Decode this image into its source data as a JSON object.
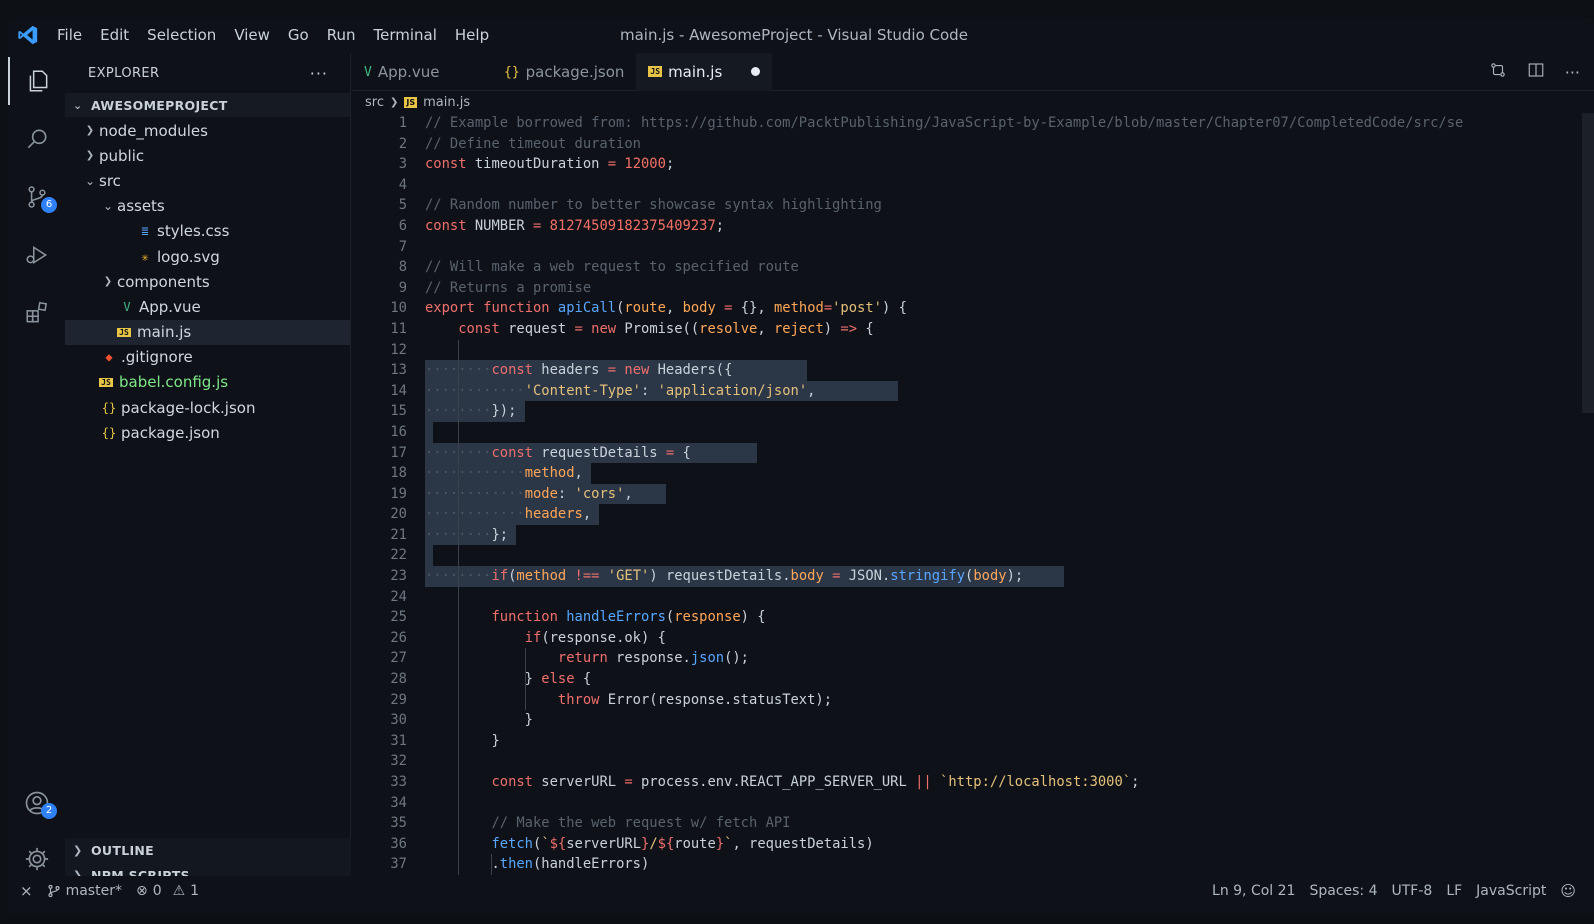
{
  "menu": [
    "File",
    "Edit",
    "Selection",
    "View",
    "Go",
    "Run",
    "Terminal",
    "Help"
  ],
  "window_title": "main.js - AwesomeProject - Visual Studio Code",
  "activity": {
    "source_control_badge": "6",
    "accounts_badge": "2"
  },
  "explorer": {
    "header": "EXPLORER",
    "project": "AWESOMEPROJECT",
    "tree": [
      {
        "label": "node_modules",
        "depth": 0,
        "twisty": ">",
        "icon": "",
        "color": "#d0d7de"
      },
      {
        "label": "public",
        "depth": 0,
        "twisty": ">",
        "icon": "",
        "color": "#d0d7de"
      },
      {
        "label": "src",
        "depth": 0,
        "twisty": "v",
        "icon": "",
        "color": "#d0d7de"
      },
      {
        "label": "assets",
        "depth": 1,
        "twisty": "v",
        "icon": "",
        "color": "#d0d7de"
      },
      {
        "label": "styles.css",
        "depth": 2,
        "twisty": "",
        "icon": "css",
        "color": "#d0d7de"
      },
      {
        "label": "logo.svg",
        "depth": 2,
        "twisty": "",
        "icon": "svg",
        "color": "#d0d7de"
      },
      {
        "label": "components",
        "depth": 1,
        "twisty": ">",
        "icon": "",
        "color": "#d0d7de"
      },
      {
        "label": "App.vue",
        "depth": 1,
        "twisty": "",
        "icon": "vue",
        "color": "#d0d7de"
      },
      {
        "label": "main.js",
        "depth": 1,
        "twisty": "",
        "icon": "js",
        "color": "#d0d7de",
        "selected": true
      },
      {
        "label": ".gitignore",
        "depth": 0,
        "twisty": "",
        "icon": "git",
        "color": "#d0d7de"
      },
      {
        "label": "babel.config.js",
        "depth": 0,
        "twisty": "",
        "icon": "js",
        "color": "#7ee787"
      },
      {
        "label": "package-lock.json",
        "depth": 0,
        "twisty": "",
        "icon": "json",
        "color": "#d0d7de"
      },
      {
        "label": "package.json",
        "depth": 0,
        "twisty": "",
        "icon": "json",
        "color": "#d0d7de"
      }
    ],
    "outline": "OUTLINE",
    "npm_scripts": "NPM SCRIPTS"
  },
  "tabs": [
    {
      "label": "App.vue",
      "icon": "vue",
      "active": false
    },
    {
      "label": "package.json",
      "icon": "json",
      "active": false
    },
    {
      "label": "main.js",
      "icon": "js",
      "active": true,
      "dirty": true
    }
  ],
  "breadcrumb": {
    "folder": "src",
    "file": "main.js"
  },
  "code_lines": [
    {
      "n": "1",
      "t": [
        [
          "c",
          "// Example borrowed from: https://github.com/PacktPublishing/JavaScript-by-Example/blob/master/Chapter07/CompletedCode/src/se"
        ]
      ]
    },
    {
      "n": "2",
      "t": [
        [
          "c",
          "// Define timeout duration"
        ]
      ]
    },
    {
      "n": "3",
      "t": [
        [
          "k",
          "const"
        ],
        [
          "w",
          " timeoutDuration "
        ],
        [
          "k",
          "="
        ],
        [
          "w",
          " "
        ],
        [
          "n",
          "12000"
        ],
        [
          "w",
          ";"
        ]
      ]
    },
    {
      "n": "4",
      "t": []
    },
    {
      "n": "5",
      "t": [
        [
          "c",
          "// Random number to better showcase syntax highlighting"
        ]
      ]
    },
    {
      "n": "6",
      "t": [
        [
          "k",
          "const"
        ],
        [
          "w",
          " NUMBER "
        ],
        [
          "k",
          "="
        ],
        [
          "w",
          " "
        ],
        [
          "n",
          "81274509182375409237"
        ],
        [
          "w",
          ";"
        ]
      ]
    },
    {
      "n": "7",
      "t": []
    },
    {
      "n": "8",
      "t": [
        [
          "c",
          "// Will make a web request to specified route"
        ]
      ]
    },
    {
      "n": "9",
      "t": [
        [
          "c",
          "// Returns a promise"
        ]
      ]
    },
    {
      "n": "10",
      "t": [
        [
          "k",
          "export"
        ],
        [
          "w",
          " "
        ],
        [
          "k",
          "function"
        ],
        [
          "w",
          " "
        ],
        [
          "f",
          "apiCall"
        ],
        [
          "w",
          "("
        ],
        [
          "p",
          "route"
        ],
        [
          "w",
          ", "
        ],
        [
          "p",
          "body"
        ],
        [
          "w",
          " "
        ],
        [
          "k",
          "="
        ],
        [
          "w",
          " {}, "
        ],
        [
          "p",
          "method"
        ],
        [
          "k",
          "="
        ],
        [
          "s",
          "'post'"
        ],
        [
          "w",
          ") {"
        ]
      ]
    },
    {
      "n": "11",
      "t": [
        [
          "w",
          "    "
        ],
        [
          "k",
          "const"
        ],
        [
          "w",
          " request "
        ],
        [
          "k",
          "="
        ],
        [
          "w",
          " "
        ],
        [
          "k",
          "new"
        ],
        [
          "w",
          " Promise(("
        ],
        [
          "p",
          "resolve"
        ],
        [
          "w",
          ", "
        ],
        [
          "p",
          "reject"
        ],
        [
          "w",
          ") "
        ],
        [
          "k",
          "=>"
        ],
        [
          "w",
          " {"
        ]
      ]
    },
    {
      "n": "12",
      "t": []
    },
    {
      "n": "13",
      "t": [
        [
          "d",
          "········"
        ],
        [
          "k",
          "const"
        ],
        [
          "w",
          " headers "
        ],
        [
          "k",
          "="
        ],
        [
          "w",
          " "
        ],
        [
          "k",
          "new"
        ],
        [
          "w",
          " Headers({"
        ]
      ],
      "sel": 46
    },
    {
      "n": "14",
      "t": [
        [
          "d",
          "············"
        ],
        [
          "s",
          "'Content-Type'"
        ],
        [
          "w",
          ": "
        ],
        [
          "s",
          "'application/json'"
        ],
        [
          "w",
          ","
        ]
      ],
      "sel": 57
    },
    {
      "n": "15",
      "t": [
        [
          "d",
          "········"
        ],
        [
          "w",
          "});"
        ]
      ],
      "sel": 12
    },
    {
      "n": "16",
      "t": [],
      "sel": 1
    },
    {
      "n": "17",
      "t": [
        [
          "d",
          "········"
        ],
        [
          "k",
          "const"
        ],
        [
          "w",
          " requestDetails "
        ],
        [
          "k",
          "="
        ],
        [
          "w",
          " {"
        ]
      ],
      "sel": 40
    },
    {
      "n": "18",
      "t": [
        [
          "d",
          "············"
        ],
        [
          "p",
          "method"
        ],
        [
          "w",
          ","
        ]
      ],
      "sel": 20
    },
    {
      "n": "19",
      "t": [
        [
          "d",
          "············"
        ],
        [
          "p",
          "mode"
        ],
        [
          "w",
          ": "
        ],
        [
          "s",
          "'cors'"
        ],
        [
          "w",
          ","
        ]
      ],
      "sel": 29
    },
    {
      "n": "20",
      "t": [
        [
          "d",
          "············"
        ],
        [
          "p",
          "headers"
        ],
        [
          "w",
          ","
        ]
      ],
      "sel": 21
    },
    {
      "n": "21",
      "t": [
        [
          "d",
          "········"
        ],
        [
          "w",
          "};"
        ]
      ],
      "sel": 11
    },
    {
      "n": "22",
      "t": [],
      "sel": 1
    },
    {
      "n": "23",
      "t": [
        [
          "d",
          "········"
        ],
        [
          "k",
          "if"
        ],
        [
          "w",
          "("
        ],
        [
          "p",
          "method"
        ],
        [
          "w",
          " "
        ],
        [
          "k",
          "!=="
        ],
        [
          "w",
          " "
        ],
        [
          "s",
          "'GET'"
        ],
        [
          "w",
          ") requestDetails."
        ],
        [
          "p",
          "body"
        ],
        [
          "w",
          " "
        ],
        [
          "k",
          "="
        ],
        [
          "w",
          " JSON."
        ],
        [
          "f",
          "stringify"
        ],
        [
          "w",
          "("
        ],
        [
          "p",
          "body"
        ],
        [
          "w",
          ");"
        ]
      ],
      "sel": 77
    },
    {
      "n": "24",
      "t": []
    },
    {
      "n": "25",
      "t": [
        [
          "w",
          "        "
        ],
        [
          "k",
          "function"
        ],
        [
          "w",
          " "
        ],
        [
          "f",
          "handleErrors"
        ],
        [
          "w",
          "("
        ],
        [
          "p",
          "response"
        ],
        [
          "w",
          ") {"
        ]
      ]
    },
    {
      "n": "26",
      "t": [
        [
          "w",
          "            "
        ],
        [
          "k",
          "if"
        ],
        [
          "w",
          "(response.ok) {"
        ]
      ]
    },
    {
      "n": "27",
      "t": [
        [
          "w",
          "                "
        ],
        [
          "k",
          "return"
        ],
        [
          "w",
          " response."
        ],
        [
          "f",
          "json"
        ],
        [
          "w",
          "();"
        ]
      ]
    },
    {
      "n": "28",
      "t": [
        [
          "w",
          "            } "
        ],
        [
          "k",
          "else"
        ],
        [
          "w",
          " {"
        ]
      ]
    },
    {
      "n": "29",
      "t": [
        [
          "w",
          "                "
        ],
        [
          "k",
          "throw"
        ],
        [
          "w",
          " Error(response.statusText);"
        ]
      ]
    },
    {
      "n": "30",
      "t": [
        [
          "w",
          "            }"
        ]
      ]
    },
    {
      "n": "31",
      "t": [
        [
          "w",
          "        }"
        ]
      ]
    },
    {
      "n": "32",
      "t": []
    },
    {
      "n": "33",
      "t": [
        [
          "w",
          "        "
        ],
        [
          "k",
          "const"
        ],
        [
          "w",
          " serverURL "
        ],
        [
          "k",
          "="
        ],
        [
          "w",
          " process.env.REACT_APP_SERVER_URL "
        ],
        [
          "k",
          "||"
        ],
        [
          "w",
          " "
        ],
        [
          "s",
          "`http://localhost:3000`"
        ],
        [
          "w",
          ";"
        ]
      ]
    },
    {
      "n": "34",
      "t": []
    },
    {
      "n": "35",
      "t": [
        [
          "w",
          "        "
        ],
        [
          "c",
          "// Make the web request w/ fetch API"
        ]
      ]
    },
    {
      "n": "36",
      "t": [
        [
          "w",
          "        "
        ],
        [
          "f",
          "fetch"
        ],
        [
          "w",
          "("
        ],
        [
          "s",
          "`"
        ],
        [
          "k",
          "${"
        ],
        [
          "w",
          "serverURL"
        ],
        [
          "k",
          "}"
        ],
        [
          "s",
          "/"
        ],
        [
          "k",
          "${"
        ],
        [
          "w",
          "route"
        ],
        [
          "k",
          "}"
        ],
        [
          "s",
          "`"
        ],
        [
          "w",
          ", requestDetails)"
        ]
      ]
    },
    {
      "n": "37",
      "t": [
        [
          "w",
          "        ."
        ],
        [
          "f",
          "then"
        ],
        [
          "w",
          "(handleErrors)"
        ]
      ]
    }
  ],
  "status": {
    "branch": "master*",
    "errors": "0",
    "warnings": "1",
    "position": "Ln 9, Col 21",
    "spaces": "Spaces: 4",
    "encoding": "UTF-8",
    "eol": "LF",
    "language": "JavaScript"
  }
}
